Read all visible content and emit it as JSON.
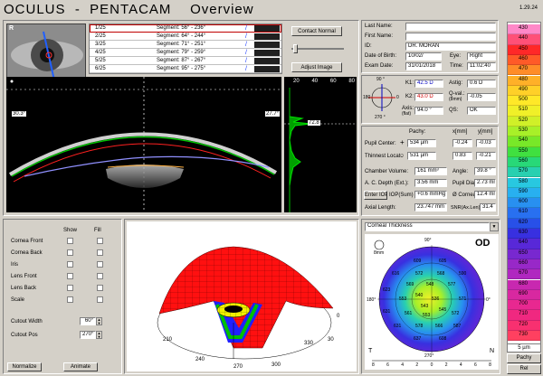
{
  "app": {
    "title": "OCULUS  -  PENTACAM    Overview",
    "date": "1.29.24"
  },
  "camera": {
    "label": "R"
  },
  "segments": [
    {
      "idx": "1/25",
      "seg": "Segment: 56° - 236°"
    },
    {
      "idx": "2/25",
      "seg": "Segment: 64° - 244°"
    },
    {
      "idx": "3/25",
      "seg": "Segment: 71° - 251°"
    },
    {
      "idx": "4/25",
      "seg": "Segment: 79° - 259°"
    },
    {
      "idx": "5/25",
      "seg": "Segment: 87° - 267°"
    },
    {
      "idx": "6/25",
      "seg": "Segment: 95° - 275°"
    }
  ],
  "buttons": {
    "contact": "Contact Normal",
    "adjust": "Adjust Image",
    "normalize": "Normalize",
    "animate": "Animate",
    "enter_iop": "Enter IOP",
    "iop_sum": "IOP(Sum)"
  },
  "scheimpflug": {
    "angle_left": "30.3°",
    "angle_right": "27.7°",
    "profile_value": "72.8",
    "scale": [
      "20",
      "40",
      "60",
      "80"
    ]
  },
  "patient": {
    "last_name_label": "Last Name:",
    "last_name": "",
    "first_name_label": "First Name:",
    "first_name": "",
    "id_label": "ID:",
    "id": "DR. MORAN",
    "dob_label": "Date of Birth:",
    "dob": "10/02/",
    "eye_label": "Eye:",
    "eye": "Right",
    "exam_label": "Exam Date:",
    "exam": "31/01/2018",
    "time_label": "Time:",
    "time": "11:02:40"
  },
  "keratometry": {
    "k1_label": "K1:",
    "k1": "42.5 D",
    "k2_label": "K2:",
    "k2": "43.0 D",
    "axis_label": "Axis:",
    "axis_sub": "(flat)",
    "axis": "94.0 °",
    "astig_label": "Astig:",
    "astig": "0.6 D",
    "qval_label": "Q-val.:",
    "qval_sub": "(8mm)",
    "qval": "-0.05",
    "qs_label": "QS:",
    "qs": "OK",
    "compass": [
      "90 °",
      "0",
      "180",
      "270 °"
    ]
  },
  "pachy": {
    "pachy_label": "Pachy:",
    "x_label": "x[mm]",
    "y_label": "y[mm]",
    "pupil_label": "Pupil Center:",
    "pupil_val": "534 µm",
    "pupil_x": "-0.24",
    "pupil_y": "-0.03",
    "thin_label": "Thinnest Locat.:",
    "thin_val": "531 µm",
    "thin_x": "0.83",
    "thin_y": "-0.21",
    "plus": "+",
    "circle": "○"
  },
  "chamber": {
    "vol_label": "Chamber Volume:",
    "vol": "161 mm³",
    "angle_label": "Angle:",
    "angle": "39.8 °",
    "depth_label": "A. C. Depth (Ext.):",
    "depth": "3.56 mm",
    "pupil_label": "Pupil Dia:",
    "pupil": "2.73 mm",
    "iop": "+0.6 mmHg",
    "cornea_label": "Ø Cornea:",
    "cornea": "12.4 mm",
    "axial_label": "Axial Length:",
    "axial": "23.747 mm",
    "snr_label": "SNR(Ax.Len)",
    "snr": "31.4"
  },
  "scale": {
    "values": [
      "430",
      "440",
      "450",
      "460",
      "470",
      "480",
      "490",
      "500",
      "510",
      "520",
      "530",
      "540",
      "550",
      "560",
      "570",
      "580",
      "590",
      "600",
      "610",
      "620",
      "630",
      "640",
      "650",
      "660",
      "670",
      "680",
      "690",
      "700",
      "710",
      "720",
      "730"
    ],
    "colors": [
      "#ff88c8",
      "#ff5078",
      "#ff2828",
      "#ff5a28",
      "#ff8c28",
      "#ffb028",
      "#ffd028",
      "#ffe828",
      "#f0f028",
      "#d0f028",
      "#a8f028",
      "#78e828",
      "#40e040",
      "#28d878",
      "#28d0b0",
      "#28c8e0",
      "#28b0f0",
      "#2890f0",
      "#2870f0",
      "#2850e8",
      "#3830e0",
      "#5828d8",
      "#7828d0",
      "#9828c8",
      "#b028c0",
      "#c828b0",
      "#d828a0",
      "#e82890",
      "#f02880",
      "#f83070",
      "#ff4060"
    ],
    "unit": "5 µm",
    "mode1": "Pachy",
    "mode2": "Rel"
  },
  "layers": {
    "show": "Show",
    "fill": "Fill",
    "items": [
      "Cornea Front",
      "Cornea Back",
      "Iris",
      "Lens Front",
      "Lens Back",
      "Scale"
    ],
    "cutout_width_label": "Cutout Width",
    "cutout_width": "60°",
    "cutout_pos_label": "Cutout Pos",
    "cutout_pos": "270°"
  },
  "model3d": {
    "ticks": [
      "0",
      "30",
      "60",
      "90",
      "120",
      "150",
      "180",
      "210",
      "240",
      "270",
      "300",
      "330"
    ]
  },
  "map": {
    "selector": "Corneal Thickness",
    "eye": "OD",
    "mm": "8mm",
    "values": [
      {
        "v": "609",
        "x": -14,
        "y": -42
      },
      {
        "v": "605",
        "x": 14,
        "y": -42
      },
      {
        "v": "616",
        "x": -38,
        "y": -28
      },
      {
        "v": "572",
        "x": -12,
        "y": -28
      },
      {
        "v": "568",
        "x": 12,
        "y": -28
      },
      {
        "v": "590",
        "x": 36,
        "y": -28
      },
      {
        "v": "623",
        "x": -48,
        "y": -10
      },
      {
        "v": "569",
        "x": -22,
        "y": -16
      },
      {
        "v": "548",
        "x": 0,
        "y": -16
      },
      {
        "v": "577",
        "x": 24,
        "y": -16
      },
      {
        "v": "553",
        "x": -30,
        "y": 0
      },
      {
        "v": "540",
        "x": -12,
        "y": -4
      },
      {
        "v": "536",
        "x": 6,
        "y": 0
      },
      {
        "v": "543",
        "x": -6,
        "y": 8
      },
      {
        "v": "571",
        "x": 36,
        "y": 0
      },
      {
        "v": "631",
        "x": -48,
        "y": 14
      },
      {
        "v": "561",
        "x": -24,
        "y": 16
      },
      {
        "v": "553",
        "x": -4,
        "y": 18
      },
      {
        "v": "545",
        "x": 14,
        "y": 12
      },
      {
        "v": "572",
        "x": 28,
        "y": 16
      },
      {
        "v": "631",
        "x": -36,
        "y": 30
      },
      {
        "v": "578",
        "x": -12,
        "y": 30
      },
      {
        "v": "566",
        "x": 10,
        "y": 30
      },
      {
        "v": "587",
        "x": 30,
        "y": 30
      },
      {
        "v": "637",
        "x": -14,
        "y": 44
      },
      {
        "v": "608",
        "x": 14,
        "y": 44
      }
    ],
    "compass": [
      "90°",
      "0°",
      "180°",
      "270°",
      "T",
      "N"
    ],
    "axis": [
      "8",
      "6",
      "4",
      "2",
      "0",
      "2",
      "4",
      "6",
      "8"
    ]
  }
}
